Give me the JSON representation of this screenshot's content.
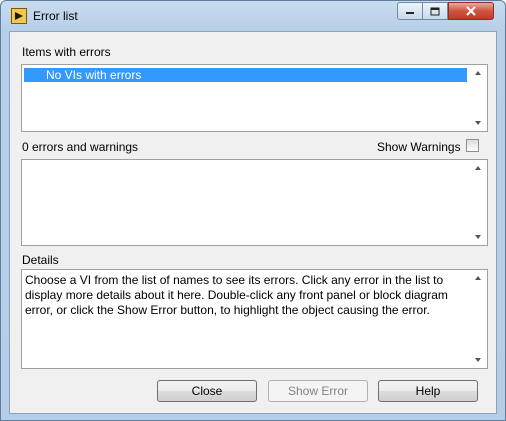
{
  "window": {
    "title": "Error list",
    "icon": "labview-icon",
    "controls": [
      "minimize-icon",
      "maximize-icon",
      "close-icon"
    ]
  },
  "items_with_errors": {
    "label": "Items with errors",
    "items": [
      {
        "text": "No VIs with errors",
        "selected": true
      }
    ]
  },
  "errors": {
    "label": "0 errors and warnings",
    "show_warnings_label": "Show Warnings",
    "show_warnings_checked": false,
    "items": []
  },
  "details": {
    "label": "Details",
    "lines": [
      "Choose a VI from the list of names to see its errors. Click any error in the list to",
      "display more details about it here. Double-click any front panel or block diagram",
      "error, or click the Show Error button, to highlight the object causing the error."
    ]
  },
  "buttons": {
    "close": "Close",
    "show_error": "Show Error",
    "help": "Help"
  }
}
